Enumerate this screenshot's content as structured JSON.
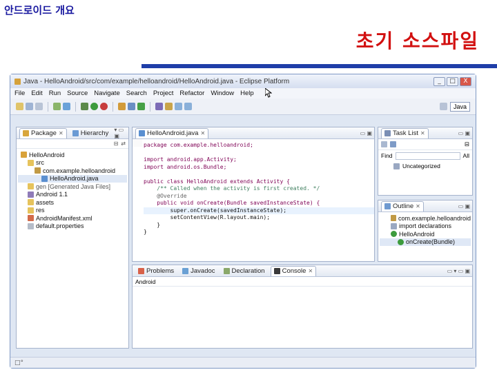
{
  "slide": {
    "header": "안드로이드 개요",
    "title": "초기 소스파일"
  },
  "window": {
    "title": "Java - HelloAndroid/src/com/example/helloandroid/HelloAndroid.java - Eclipse Platform",
    "buttons": [
      "_",
      "□",
      "X"
    ]
  },
  "menu": [
    "File",
    "Edit",
    "Run",
    "Source",
    "Navigate",
    "Search",
    "Project",
    "Refactor",
    "Window",
    "Help"
  ],
  "perspective": {
    "label": "Java"
  },
  "package_explorer": {
    "tabs": [
      "Package",
      "Hierarchy"
    ],
    "items": [
      {
        "label": "HelloAndroid",
        "indent": 0,
        "icon": "project-icon"
      },
      {
        "label": "src",
        "indent": 1,
        "icon": "folder-icon"
      },
      {
        "label": "com.example.helloandroid",
        "indent": 2,
        "icon": "package-icon"
      },
      {
        "label": "HelloAndroid.java",
        "indent": 3,
        "icon": "java-file-icon"
      },
      {
        "label": "gen [Generated Java Files]",
        "indent": 1,
        "icon": "folder-icon"
      },
      {
        "label": "Android 1.1",
        "indent": 1,
        "icon": "library-icon"
      },
      {
        "label": "assets",
        "indent": 1,
        "icon": "folder-icon"
      },
      {
        "label": "res",
        "indent": 1,
        "icon": "folder-icon"
      },
      {
        "label": "AndroidManifest.xml",
        "indent": 1,
        "icon": "xml-file-icon"
      },
      {
        "label": "default.properties",
        "indent": 1,
        "icon": "file-icon"
      }
    ]
  },
  "editor": {
    "tab": "HelloAndroid.java",
    "lines": [
      "package com.example.helloandroid;",
      "",
      "import android.app.Activity;",
      "import android.os.Bundle;",
      "",
      "public class HelloAndroid extends Activity {",
      "    /** Called when the activity is first created. */",
      "    @Override",
      "    public void onCreate(Bundle savedInstanceState) {",
      "        super.onCreate(savedInstanceState);",
      "        setContentView(R.layout.main);",
      "    }",
      "}"
    ]
  },
  "task_list": {
    "tab": "Task List",
    "find_label": "Find",
    "all_label": "All",
    "category": "Uncategorized"
  },
  "outline": {
    "tab": "Outline",
    "items": [
      {
        "label": "com.example.helloandroid",
        "indent": 0
      },
      {
        "label": "import declarations",
        "indent": 0
      },
      {
        "label": "HelloAndroid",
        "indent": 0
      },
      {
        "label": "onCreate(Bundle)",
        "indent": 1
      }
    ]
  },
  "bottom_panel": {
    "tabs": [
      "Problems",
      "Javadoc",
      "Declaration",
      "Console"
    ],
    "console_name": "Android"
  },
  "colors": {
    "header": "#1a1aa0",
    "title": "#d21010",
    "rule": "#1f3ea8"
  }
}
